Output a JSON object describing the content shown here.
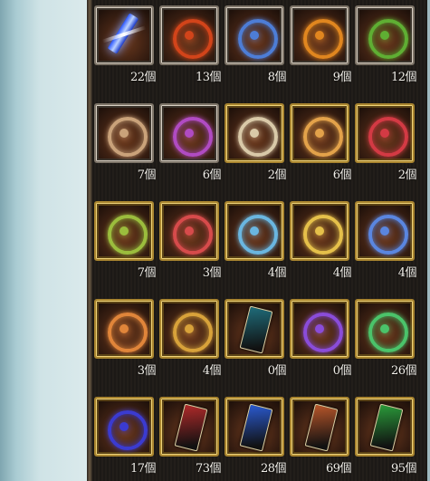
{
  "unit": "個",
  "rows": [
    [
      {
        "kind": "crystal",
        "color": "#4a6dff",
        "count": "22"
      },
      {
        "kind": "ring",
        "color": "#d2441a",
        "count": "13"
      },
      {
        "kind": "ring",
        "color": "#4d7dd6",
        "count": "8"
      },
      {
        "kind": "ring",
        "color": "#e0861f",
        "count": "9"
      },
      {
        "kind": "ring",
        "color": "#5fae33",
        "count": "12"
      }
    ],
    [
      {
        "kind": "ring",
        "color": "#c9a27a",
        "count": "7"
      },
      {
        "kind": "ring",
        "color": "#b04bc2",
        "count": "6"
      },
      {
        "kind": "ring",
        "color": "#d9c9a8",
        "count": "2"
      },
      {
        "kind": "ring",
        "color": "#e3a24a",
        "count": "6"
      },
      {
        "kind": "ring",
        "color": "#d33a44",
        "count": "2"
      }
    ],
    [
      {
        "kind": "ring",
        "color": "#9bbd3d",
        "count": "7"
      },
      {
        "kind": "ring",
        "color": "#d64b4b",
        "count": "3"
      },
      {
        "kind": "ring",
        "color": "#6ab6e0",
        "count": "4"
      },
      {
        "kind": "ring",
        "color": "#e5c04a",
        "count": "4"
      },
      {
        "kind": "ring",
        "color": "#5a86e0",
        "count": "4"
      }
    ],
    [
      {
        "kind": "ring",
        "color": "#e0853a",
        "count": "3"
      },
      {
        "kind": "ring",
        "color": "#d8a23a",
        "count": "4"
      },
      {
        "kind": "plate",
        "color": "#1f6c7a",
        "count": "0"
      },
      {
        "kind": "ring",
        "color": "#8a4cd9",
        "count": "0"
      },
      {
        "kind": "ring",
        "color": "#4bc36a",
        "count": "26"
      }
    ],
    [
      {
        "kind": "ring",
        "color": "#3b3bd0",
        "count": "17"
      },
      {
        "kind": "plate",
        "color": "#b02a2a",
        "count": "73"
      },
      {
        "kind": "plate",
        "color": "#2a5ad0",
        "count": "28"
      },
      {
        "kind": "plate",
        "color": "#b8562a",
        "count": "69"
      },
      {
        "kind": "plate",
        "color": "#2a9a3a",
        "count": "95"
      }
    ]
  ],
  "gold_frames": [
    [
      false,
      false,
      false,
      false,
      false
    ],
    [
      false,
      false,
      true,
      true,
      true
    ],
    [
      true,
      true,
      true,
      true,
      true
    ],
    [
      true,
      true,
      true,
      true,
      true
    ],
    [
      true,
      true,
      true,
      true,
      true
    ]
  ]
}
